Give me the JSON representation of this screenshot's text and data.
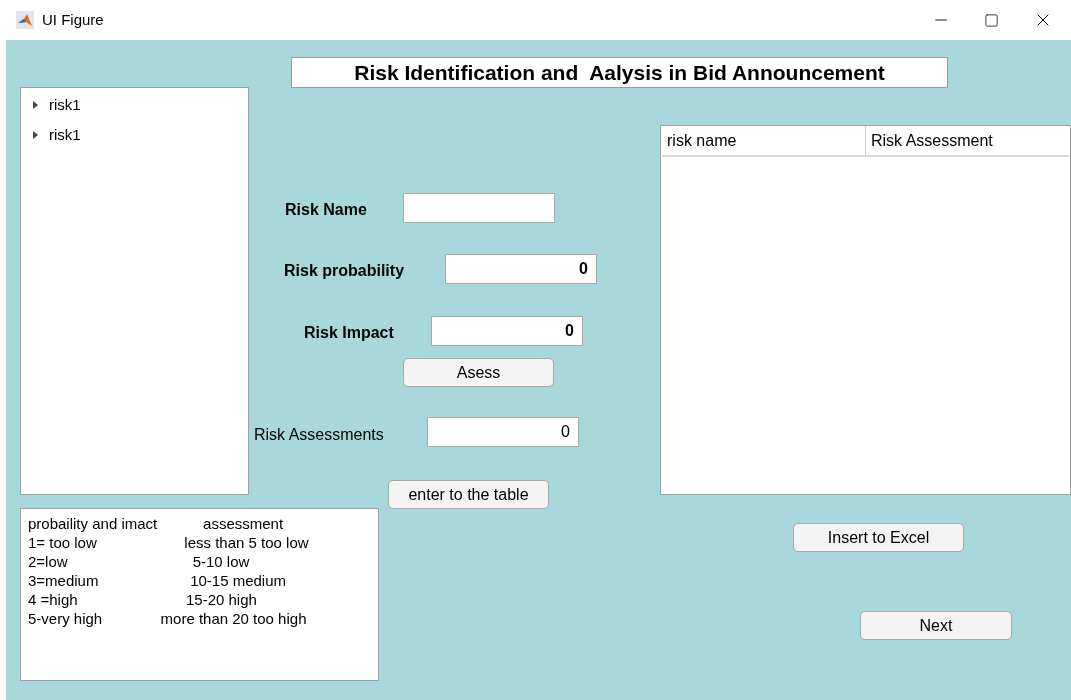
{
  "window": {
    "title": "UI Figure"
  },
  "heading": "Risk Identification and  Aalysis in Bid Announcement",
  "tree": {
    "items": [
      {
        "label": "risk1",
        "expanded": false
      },
      {
        "label": "risk1",
        "expanded": false
      }
    ]
  },
  "fields": [
    {
      "label": "Risk Name"
    },
    {
      "label": "Risk probability",
      "value": "0"
    },
    {
      "label": "Risk Impact",
      "value": "0"
    }
  ],
  "assess_button": "Asess",
  "result": {
    "label": "Risk Assessments",
    "value": "0"
  },
  "enter_button": "enter to the table",
  "legend": [
    "probaility and imact           assessment",
    "1= too low                     less than 5 too low",
    "2=low                              5-10 low",
    "3=medium                      10-15 medium",
    "4 =high                          15-20 high",
    "5-very high              more than 20 too high"
  ],
  "table": {
    "columns": [
      "risk name",
      "Risk Assessment"
    ]
  },
  "excel_button": "Insert to Excel",
  "next_button": "Next"
}
